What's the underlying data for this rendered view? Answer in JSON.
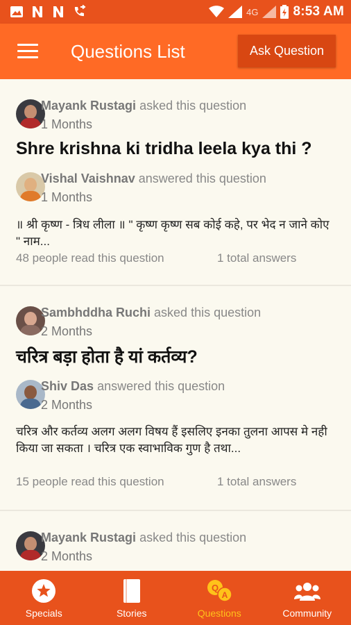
{
  "status_bar": {
    "time": "8:53 AM",
    "network": "4G"
  },
  "app_bar": {
    "title": "Questions List",
    "ask_button": "Ask Question"
  },
  "questions": [
    {
      "asker": "Mayank Rustagi",
      "asked_text": "asked this question",
      "asked_when": "1 Months",
      "title": "Shre krishna ki tridha leela kya thi ?",
      "answerer": "Vishal Vaishnav",
      "answered_text": "answered this question",
      "answered_when": "1 Months",
      "snippet": "॥ श्री कृष्ण - त्रिध लीला ॥ \" कृष्ण कृष्ण सब कोई कहे, पर भेद न जाने कोए \" नाम...",
      "reads": "48 people read this question",
      "answers": "1 total answers"
    },
    {
      "asker": "Sambhddha Ruchi",
      "asked_text": "asked this question",
      "asked_when": "2 Months",
      "title": "चरित्र बड़ा होता है यां कर्तव्य?",
      "answerer": "Shiv Das",
      "answered_text": "answered this question",
      "answered_when": "2 Months",
      "snippet": "चरित्र और कर्तव्य अलग अलग विषय हैं इसलिए इनका तुलना आपस मे नही किया जा सकता । चरित्र एक स्वाभाविक गुण है तथा...",
      "reads": "15 people read this question",
      "answers": "1 total answers"
    },
    {
      "asker": "Mayank Rustagi",
      "asked_text": "asked this question",
      "asked_when": "2 Months"
    }
  ],
  "bottom_nav": [
    {
      "label": "Specials",
      "icon": "star-circle-icon"
    },
    {
      "label": "Stories",
      "icon": "book-icon"
    },
    {
      "label": "Questions",
      "icon": "qa-icon",
      "active": true
    },
    {
      "label": "Community",
      "icon": "people-icon"
    }
  ],
  "colors": {
    "status_bar": "#e8521c",
    "app_bar": "#ff6a25",
    "accent_active": "#ffc21a",
    "background": "#fbf9ef"
  }
}
